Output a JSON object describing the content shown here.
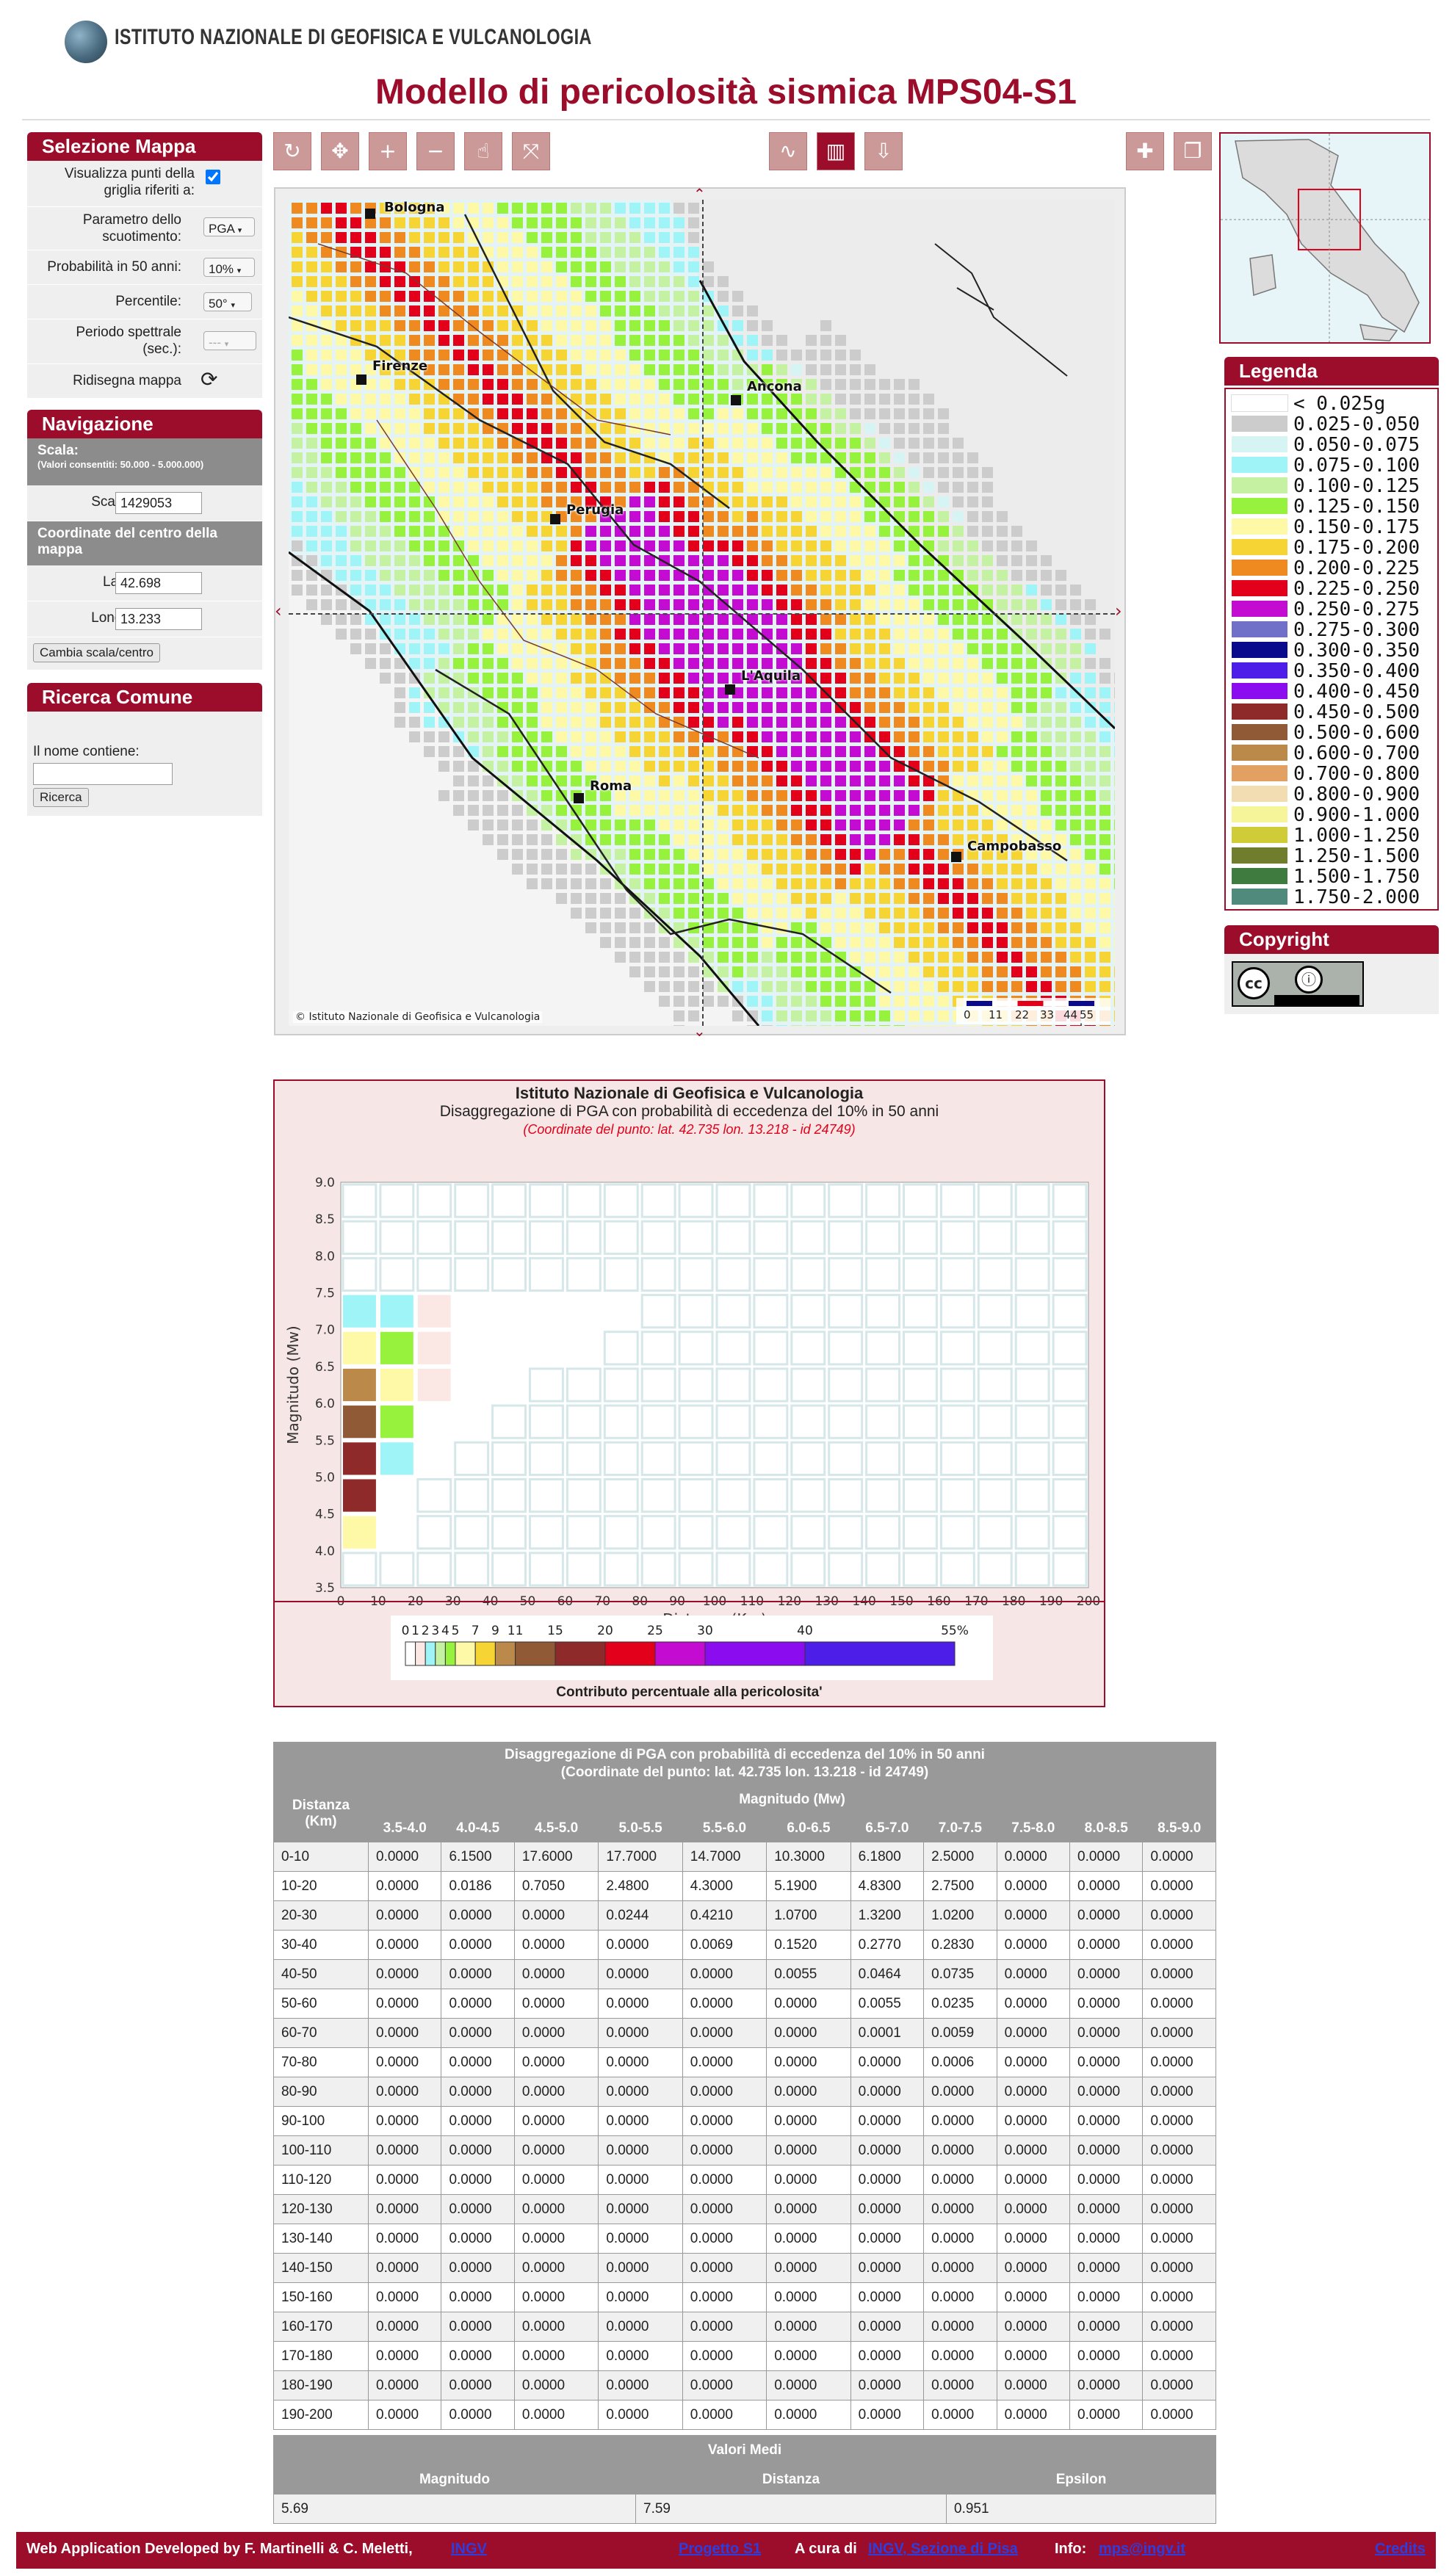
{
  "header": {
    "org_name": "ISTITUTO NAZIONALE DI GEOFISICA E VULCANOLOGIA",
    "title": "Modello di pericolosità sismica MPS04-S1"
  },
  "sidebar": {
    "selezione": {
      "title": "Selezione Mappa",
      "grid_points_label": "Visualizza punti della griglia riferiti a:",
      "grid_points_checked": true,
      "param_label": "Parametro dello scuotimento:",
      "param_value": "PGA",
      "prob_label": "Probabilità in 50 anni:",
      "prob_value": "10%",
      "percentile_label": "Percentile:",
      "percentile_value": "50°",
      "period_label": "Periodo spettrale (sec.):",
      "period_value": "---",
      "redraw_label": "Ridisegna mappa"
    },
    "navigazione": {
      "title": "Navigazione",
      "scale_header": "Scala:",
      "scale_note": "(Valori consentiti: 50.000 - 5.000.000)",
      "scale_label": "Scala:",
      "scale_value": "1429053",
      "coord_header": "Coordinate del centro della mappa",
      "lat_label": "Lat.:",
      "lat_value": "42.698",
      "lon_label": "Long.:",
      "lon_value": "13.233",
      "change_button": "Cambia scala/centro"
    },
    "ricerca": {
      "title": "Ricerca Comune",
      "name_label": "Il nome contiene:",
      "name_value": "",
      "search_button": "Ricerca"
    }
  },
  "map": {
    "cities": [
      "Bologna",
      "Firenze",
      "Ancona",
      "Perugia",
      "L'Aquila",
      "Roma",
      "Campobasso"
    ],
    "copyright": "© Istituto Nazionale di Geofisica e Vulcanologia",
    "scale_ticks": [
      "0",
      "11",
      "22",
      "33",
      "44",
      "55 km"
    ]
  },
  "legend": {
    "title": "Legenda",
    "items": [
      {
        "label": "< 0.025g",
        "color": "#ffffff"
      },
      {
        "label": "0.025-0.050",
        "color": "#cccccc"
      },
      {
        "label": "0.050-0.075",
        "color": "#d7f4f4"
      },
      {
        "label": "0.075-0.100",
        "color": "#9ff4f7"
      },
      {
        "label": "0.100-0.125",
        "color": "#c4f2a2"
      },
      {
        "label": "0.125-0.150",
        "color": "#96f23c"
      },
      {
        "label": "0.150-0.175",
        "color": "#fdf9a6"
      },
      {
        "label": "0.175-0.200",
        "color": "#f5d433"
      },
      {
        "label": "0.200-0.225",
        "color": "#ef8a20"
      },
      {
        "label": "0.225-0.250",
        "color": "#e2001a"
      },
      {
        "label": "0.250-0.275",
        "color": "#c40bd1"
      },
      {
        "label": "0.275-0.300",
        "color": "#7070c8"
      },
      {
        "label": "0.300-0.350",
        "color": "#0a0a8c"
      },
      {
        "label": "0.350-0.400",
        "color": "#4d1ee8"
      },
      {
        "label": "0.400-0.450",
        "color": "#8c0cf0"
      },
      {
        "label": "0.450-0.500",
        "color": "#8e2a2a"
      },
      {
        "label": "0.500-0.600",
        "color": "#8f5a35"
      },
      {
        "label": "0.600-0.700",
        "color": "#bb8a4a"
      },
      {
        "label": "0.700-0.800",
        "color": "#e2a062"
      },
      {
        "label": "0.800-0.900",
        "color": "#f2ddb3"
      },
      {
        "label": "0.900-1.000",
        "color": "#f7f59a"
      },
      {
        "label": "1.000-1.250",
        "color": "#cfcc38"
      },
      {
        "label": "1.250-1.500",
        "color": "#6f7d2c"
      },
      {
        "label": "1.500-1.750",
        "color": "#3f7a3f"
      },
      {
        "label": "1.750-2.000",
        "color": "#4f8a7c"
      }
    ]
  },
  "copyright_panel": {
    "title": "Copyright"
  },
  "chart_data": {
    "type": "heatmap",
    "title": "Istituto Nazionale di Geofisica e Vulcanologia",
    "subtitle": "Disaggregazione di PGA con probabilità di eccedenza del 10% in 50 anni",
    "point_note": "(Coordinate del punto: lat. 42.735 lon. 13.218 - id 24749)",
    "xlabel": "Distanza (Km)",
    "ylabel": "Magnitudo (Mw)",
    "xlim": [
      0,
      200
    ],
    "ylim": [
      3.5,
      9.0
    ],
    "x_ticks": [
      "0",
      "10",
      "20",
      "30",
      "40",
      "50",
      "60",
      "70",
      "80",
      "90",
      "100",
      "110",
      "120",
      "130",
      "140",
      "150",
      "160",
      "170",
      "180",
      "190",
      "200"
    ],
    "y_ticks": [
      "3.5",
      "4.0",
      "4.5",
      "5.0",
      "5.5",
      "6.0",
      "6.5",
      "7.0",
      "7.5",
      "8.0",
      "8.5",
      "9.0"
    ],
    "color_scale": {
      "title": "Contributo percentuale alla pericolosita'",
      "ticks": [
        "0",
        "1",
        "2",
        "3",
        "4",
        "5",
        "7",
        "9",
        "11",
        "15",
        "20",
        "25",
        "30",
        "40",
        "55%"
      ],
      "colors": [
        "#ffffff",
        "#fbe8e4",
        "#9ff4f7",
        "#c4f2a2",
        "#96f23c",
        "#fdf9a6",
        "#f5d433",
        "#bb8a4a",
        "#8f5a35",
        "#8e2a2a",
        "#e2001a",
        "#c40bd1",
        "#8c0cf0",
        "#4d1ee8",
        "#0a0a8c"
      ]
    }
  },
  "table": {
    "title": "Disaggregazione di PGA con probabilità di eccedenza del 10% in 50 anni",
    "subtitle": "(Coordinate del punto: lat. 42.735 lon. 13.218 - id 24749)",
    "dist_header": "Distanza (Km)",
    "mag_header": "Magnitudo (Mw)",
    "columns": [
      "3.5-4.0",
      "4.0-4.5",
      "4.5-5.0",
      "5.0-5.5",
      "5.5-6.0",
      "6.0-6.5",
      "6.5-7.0",
      "7.0-7.5",
      "7.5-8.0",
      "8.0-8.5",
      "8.5-9.0"
    ],
    "rows": [
      [
        "0-10",
        "0.0000",
        "6.1500",
        "17.6000",
        "17.7000",
        "14.7000",
        "10.3000",
        "6.1800",
        "2.5000",
        "0.0000",
        "0.0000",
        "0.0000"
      ],
      [
        "10-20",
        "0.0000",
        "0.0186",
        "0.7050",
        "2.4800",
        "4.3000",
        "5.1900",
        "4.8300",
        "2.7500",
        "0.0000",
        "0.0000",
        "0.0000"
      ],
      [
        "20-30",
        "0.0000",
        "0.0000",
        "0.0000",
        "0.0244",
        "0.4210",
        "1.0700",
        "1.3200",
        "1.0200",
        "0.0000",
        "0.0000",
        "0.0000"
      ],
      [
        "30-40",
        "0.0000",
        "0.0000",
        "0.0000",
        "0.0000",
        "0.0069",
        "0.1520",
        "0.2770",
        "0.2830",
        "0.0000",
        "0.0000",
        "0.0000"
      ],
      [
        "40-50",
        "0.0000",
        "0.0000",
        "0.0000",
        "0.0000",
        "0.0000",
        "0.0055",
        "0.0464",
        "0.0735",
        "0.0000",
        "0.0000",
        "0.0000"
      ],
      [
        "50-60",
        "0.0000",
        "0.0000",
        "0.0000",
        "0.0000",
        "0.0000",
        "0.0000",
        "0.0055",
        "0.0235",
        "0.0000",
        "0.0000",
        "0.0000"
      ],
      [
        "60-70",
        "0.0000",
        "0.0000",
        "0.0000",
        "0.0000",
        "0.0000",
        "0.0000",
        "0.0001",
        "0.0059",
        "0.0000",
        "0.0000",
        "0.0000"
      ],
      [
        "70-80",
        "0.0000",
        "0.0000",
        "0.0000",
        "0.0000",
        "0.0000",
        "0.0000",
        "0.0000",
        "0.0006",
        "0.0000",
        "0.0000",
        "0.0000"
      ],
      [
        "80-90",
        "0.0000",
        "0.0000",
        "0.0000",
        "0.0000",
        "0.0000",
        "0.0000",
        "0.0000",
        "0.0000",
        "0.0000",
        "0.0000",
        "0.0000"
      ],
      [
        "90-100",
        "0.0000",
        "0.0000",
        "0.0000",
        "0.0000",
        "0.0000",
        "0.0000",
        "0.0000",
        "0.0000",
        "0.0000",
        "0.0000",
        "0.0000"
      ],
      [
        "100-110",
        "0.0000",
        "0.0000",
        "0.0000",
        "0.0000",
        "0.0000",
        "0.0000",
        "0.0000",
        "0.0000",
        "0.0000",
        "0.0000",
        "0.0000"
      ],
      [
        "110-120",
        "0.0000",
        "0.0000",
        "0.0000",
        "0.0000",
        "0.0000",
        "0.0000",
        "0.0000",
        "0.0000",
        "0.0000",
        "0.0000",
        "0.0000"
      ],
      [
        "120-130",
        "0.0000",
        "0.0000",
        "0.0000",
        "0.0000",
        "0.0000",
        "0.0000",
        "0.0000",
        "0.0000",
        "0.0000",
        "0.0000",
        "0.0000"
      ],
      [
        "130-140",
        "0.0000",
        "0.0000",
        "0.0000",
        "0.0000",
        "0.0000",
        "0.0000",
        "0.0000",
        "0.0000",
        "0.0000",
        "0.0000",
        "0.0000"
      ],
      [
        "140-150",
        "0.0000",
        "0.0000",
        "0.0000",
        "0.0000",
        "0.0000",
        "0.0000",
        "0.0000",
        "0.0000",
        "0.0000",
        "0.0000",
        "0.0000"
      ],
      [
        "150-160",
        "0.0000",
        "0.0000",
        "0.0000",
        "0.0000",
        "0.0000",
        "0.0000",
        "0.0000",
        "0.0000",
        "0.0000",
        "0.0000",
        "0.0000"
      ],
      [
        "160-170",
        "0.0000",
        "0.0000",
        "0.0000",
        "0.0000",
        "0.0000",
        "0.0000",
        "0.0000",
        "0.0000",
        "0.0000",
        "0.0000",
        "0.0000"
      ],
      [
        "170-180",
        "0.0000",
        "0.0000",
        "0.0000",
        "0.0000",
        "0.0000",
        "0.0000",
        "0.0000",
        "0.0000",
        "0.0000",
        "0.0000",
        "0.0000"
      ],
      [
        "180-190",
        "0.0000",
        "0.0000",
        "0.0000",
        "0.0000",
        "0.0000",
        "0.0000",
        "0.0000",
        "0.0000",
        "0.0000",
        "0.0000",
        "0.0000"
      ],
      [
        "190-200",
        "0.0000",
        "0.0000",
        "0.0000",
        "0.0000",
        "0.0000",
        "0.0000",
        "0.0000",
        "0.0000",
        "0.0000",
        "0.0000",
        "0.0000"
      ]
    ]
  },
  "valori_medi": {
    "title": "Valori Medi",
    "headers": [
      "Magnitudo",
      "Distanza",
      "Epsilon"
    ],
    "values": [
      "5.69",
      "7.59",
      "0.951"
    ]
  },
  "footer": {
    "developed_by": "Web Application Developed by F. Martinelli & C. Meletti,",
    "ingv": "INGV",
    "project": "Progetto S1",
    "cura_prefix": "A cura di",
    "section": "INGV, Sezione di Pisa",
    "info_prefix": "Info:",
    "email": "mps@ingv.it",
    "credits": "Credits"
  }
}
